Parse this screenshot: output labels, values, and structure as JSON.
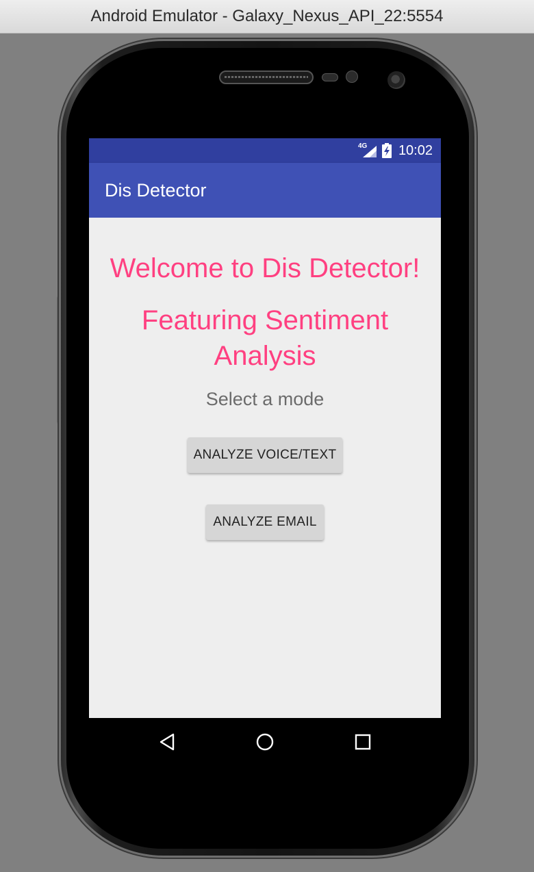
{
  "window": {
    "title": "Android Emulator - Galaxy_Nexus_API_22:5554"
  },
  "status_bar": {
    "network_label": "4G",
    "time": "10:02",
    "icons": [
      "signal-icon",
      "battery-charging-icon"
    ]
  },
  "app_bar": {
    "title": "Dis Detector"
  },
  "main": {
    "welcome": "Welcome to Dis Detector!",
    "featuring": "Featuring Sentiment Analysis",
    "select_mode": "Select a mode",
    "buttons": {
      "analyze_voice_text": "ANALYZE VOICE/TEXT",
      "analyze_email": "ANALYZE EMAIL"
    }
  },
  "nav_bar": {
    "icons": [
      "back-icon",
      "home-icon",
      "recents-icon"
    ]
  },
  "colors": {
    "status_bar": "#303f9f",
    "app_bar": "#3f51b5",
    "accent_text": "#ff4081",
    "content_bg": "#eeeeee",
    "button_bg": "#d6d6d6"
  }
}
